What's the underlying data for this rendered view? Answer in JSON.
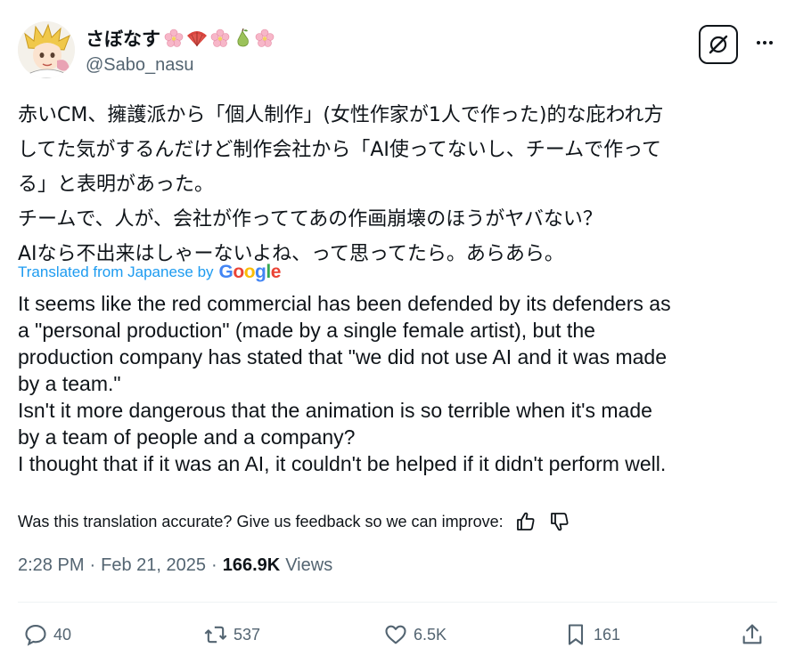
{
  "author": {
    "display_name": "さぼなす",
    "emojis": [
      "cherry-blossom-emoji",
      "fan-emoji",
      "cherry-blossom-emoji",
      "pear-emoji",
      "cherry-blossom-emoji"
    ],
    "handle": "@Sabo_nasu"
  },
  "post": {
    "original_text": "赤いCM、擁護派から「個人制作」(女性作家が1人で作った)的な庇われ方\nしてた気がするんだけど制作会社から「AI使ってないし、チームで作って\nる」と表明があった。\nチームで、人が、会社が作っててあの作画崩壊のほうがヤバない？\nAIなら不出来はしゃーないよね、って思ってたら。あらあら。",
    "translated_label": "Translated from Japanese by",
    "translator_logo": "Google",
    "translation": "It seems like the red commercial has been defended by its defenders as\na \"personal production\" (made by a single female artist), but the\nproduction company has stated that \"we did not use AI and it was made\nby a team.\"\nIsn't it more dangerous that the animation is so terrible when it's made\nby a team of people and a company?\nI thought that if it was an AI, it couldn't be helped if it didn't perform well.",
    "feedback_prompt": "Was this translation accurate? Give us feedback so we can improve:",
    "time": "2:28 PM",
    "separator": "·",
    "date": "Feb 21, 2025",
    "views_count": "166.9K",
    "views_label": "Views"
  },
  "actions": {
    "replies": "40",
    "reposts": "537",
    "likes": "6.5K",
    "bookmarks": "161"
  },
  "colors": {
    "text": "#0f1419",
    "secondary": "#536471",
    "link": "#1d9bf0",
    "divider": "#eff3f4"
  }
}
